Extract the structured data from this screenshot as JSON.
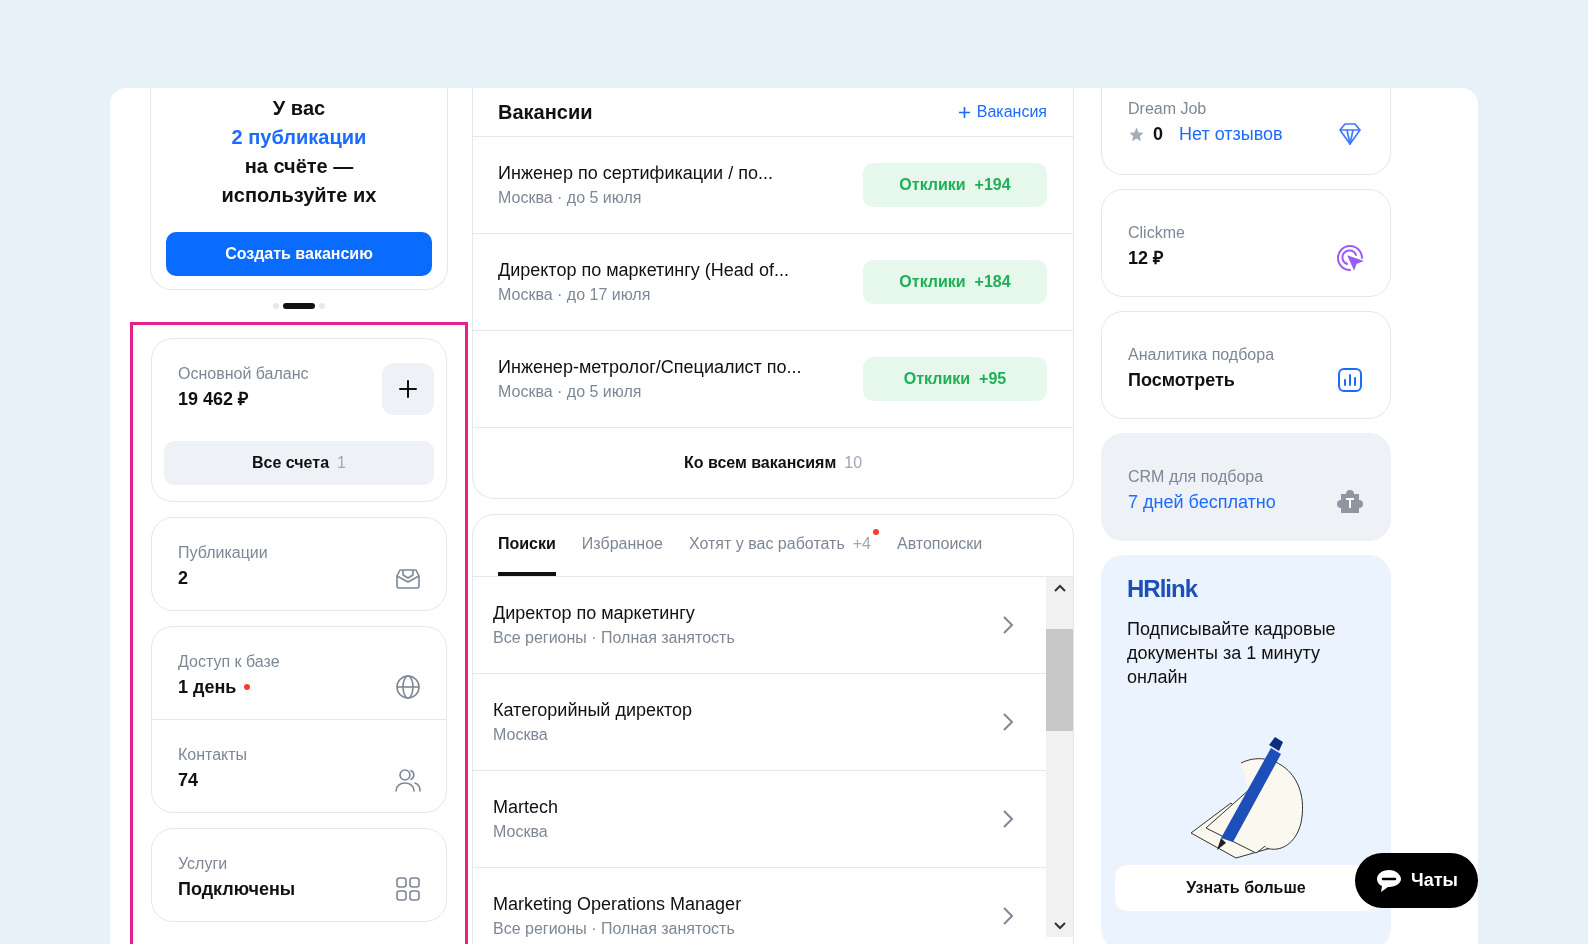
{
  "promo": {
    "lines": [
      {
        "text": "У вас",
        "accent": false
      },
      {
        "text": "2 публикации",
        "accent": true
      },
      {
        "text": "на счёте —",
        "accent": false
      },
      {
        "text": "используйте их",
        "accent": false
      }
    ],
    "button": "Создать вакансию"
  },
  "pager": [
    {
      "selected": false
    },
    {
      "selected": true
    },
    {
      "selected": false
    }
  ],
  "balance": {
    "label": "Основной баланс",
    "value": "19 462 ₽",
    "accounts_button": "Все счета",
    "accounts_count": "1"
  },
  "stat_cards": [
    {
      "items": [
        {
          "label": "Публикации",
          "value": "2",
          "alert": false,
          "kind": "inbox"
        }
      ]
    },
    {
      "items": [
        {
          "label": "Доступ к базе",
          "value": "1 день",
          "alert": true,
          "kind": "globe"
        },
        {
          "label": "Контакты",
          "value": "74",
          "alert": false,
          "kind": "people"
        }
      ]
    },
    {
      "items": [
        {
          "label": "Услуги",
          "value": "Подключены",
          "alert": false,
          "kind": "grid"
        }
      ]
    }
  ],
  "vacancies": {
    "title": "Вакансии",
    "add_link": "Вакансия",
    "rows": [
      {
        "title": "Инженер по сертификации / по...",
        "meta": "Москва · до 5 июля",
        "responses_label": "Отклики",
        "responses_count": "+194"
      },
      {
        "title": "Директор по маркетингу (Head of...",
        "meta": "Москва · до 17 июля",
        "responses_label": "Отклики",
        "responses_count": "+184"
      },
      {
        "title": "Инженер-метролог/Специалист по...",
        "meta": "Москва · до 5 июля",
        "responses_label": "Отклики",
        "responses_count": "+95"
      }
    ],
    "all_link": "Ко всем вакансиям",
    "all_count": "10"
  },
  "searches": {
    "tabs": [
      {
        "label": "Поиски",
        "selected": true,
        "alert": false
      },
      {
        "label": "Избранное",
        "selected": false,
        "alert": false
      },
      {
        "label": "Хотят у вас работать",
        "count": "+4",
        "selected": false,
        "alert": true
      },
      {
        "label": "Автопоиски",
        "selected": false,
        "alert": false
      }
    ],
    "rows": [
      {
        "title": "Директор по маркетингу",
        "meta": "Все регионы · Полная занятость"
      },
      {
        "title": "Категорийный директор",
        "meta": "Москва"
      },
      {
        "title": "Martech",
        "meta": "Москва"
      },
      {
        "title": "Marketing Operations Manager",
        "meta": "Все регионы · Полная занятость"
      }
    ]
  },
  "services": [
    {
      "kind": "rating",
      "label": "Dream Job",
      "value": "0",
      "link": "Нет отзывов",
      "highlighted": false
    },
    {
      "kind": "value",
      "label": "Clickme",
      "value": "12 ₽",
      "highlighted": false
    },
    {
      "kind": "value",
      "label": "Аналитика подбора",
      "value": "Посмотреть",
      "highlighted": false
    },
    {
      "kind": "link",
      "label": "CRM для подбора",
      "value": "7 дней бесплатно",
      "highlighted": true
    }
  ],
  "ad": {
    "logo": "HRlink",
    "text": "Подписывайте кадровые документы за 1 минуту онлайн",
    "button": "Узнать больше"
  },
  "chat": {
    "label": "Чаты"
  }
}
